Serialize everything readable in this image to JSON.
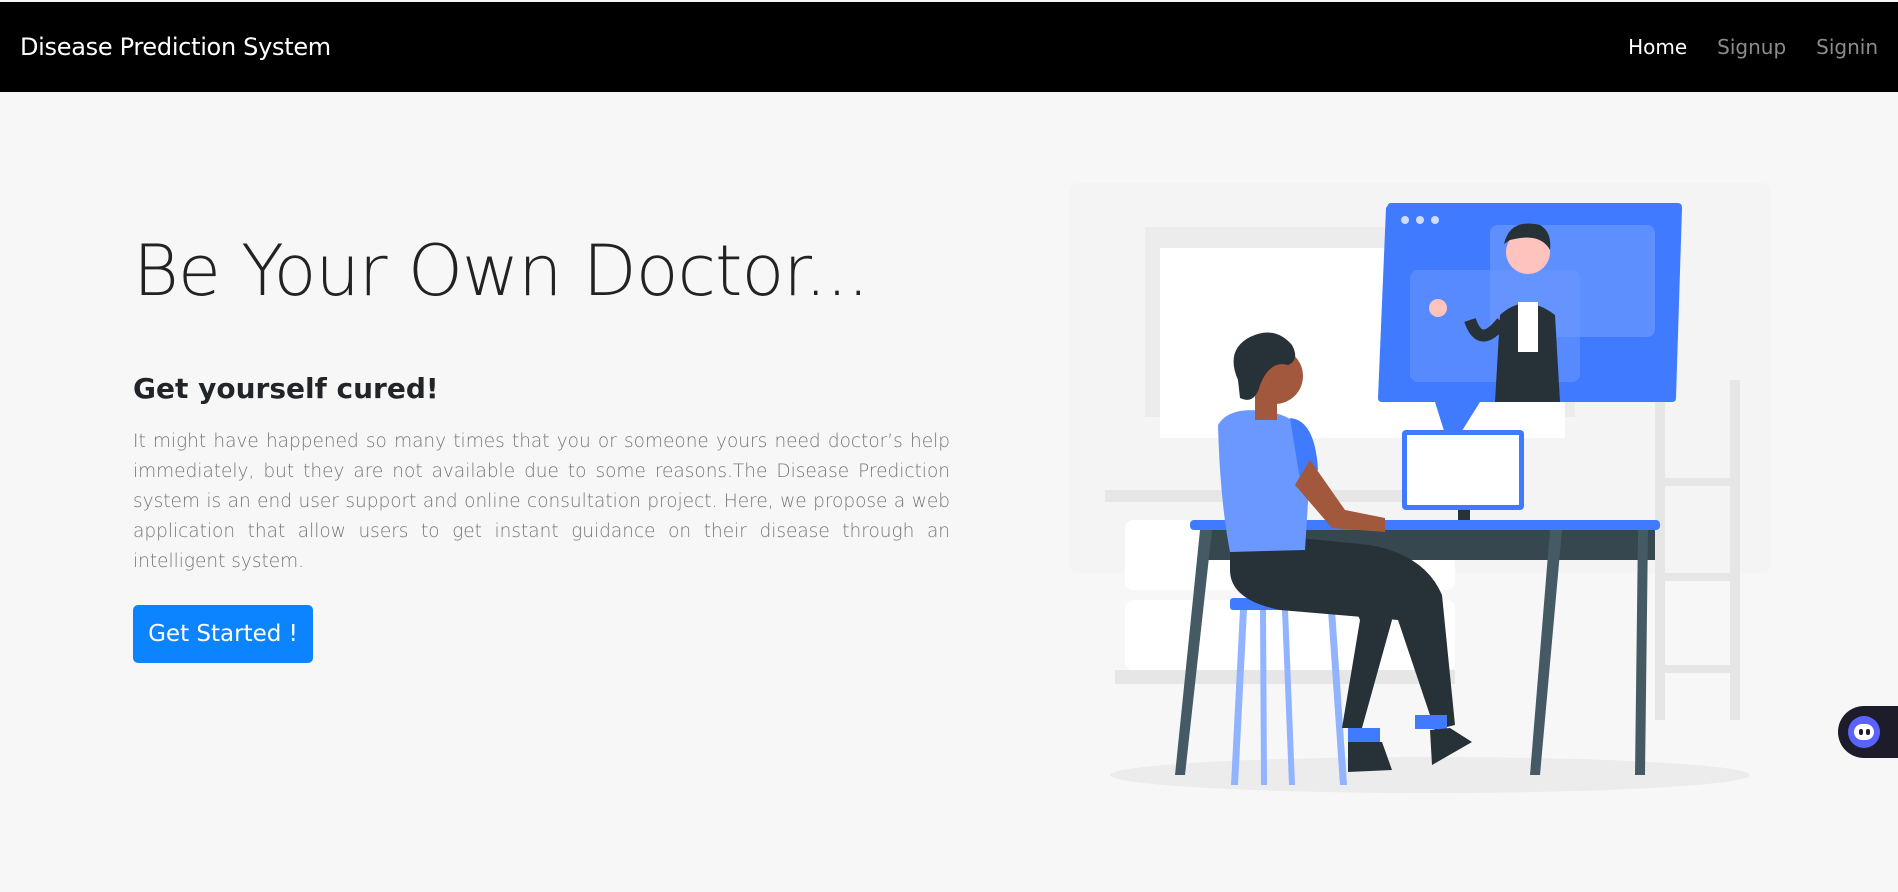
{
  "nav": {
    "brand": "Disease Prediction System",
    "links": [
      {
        "label": "Home",
        "active": true
      },
      {
        "label": "Signup",
        "active": false
      },
      {
        "label": "Signin",
        "active": false
      }
    ]
  },
  "hero": {
    "title": "Be Your Own Doctor...",
    "subtitle": "Get yourself cured!",
    "description": "It might have happened so many times that you or someone yours need doctor’s help immediately, but they are not available due to some reasons.The Disease Prediction system is an end user support and online consultation project. Here, we propose a web application that allow users to get instant guidance on their disease through an intelligent system.",
    "cta_label": "Get Started !"
  },
  "illustration": {
    "icon": "online-doctor-consultation-illustration"
  },
  "chat_widget": {
    "icon": "chat-bot-icon"
  },
  "colors": {
    "navbar_bg": "#000000",
    "page_bg": "#f7f7f7",
    "primary": "#0d84ff",
    "accent_blue": "#407bff"
  }
}
